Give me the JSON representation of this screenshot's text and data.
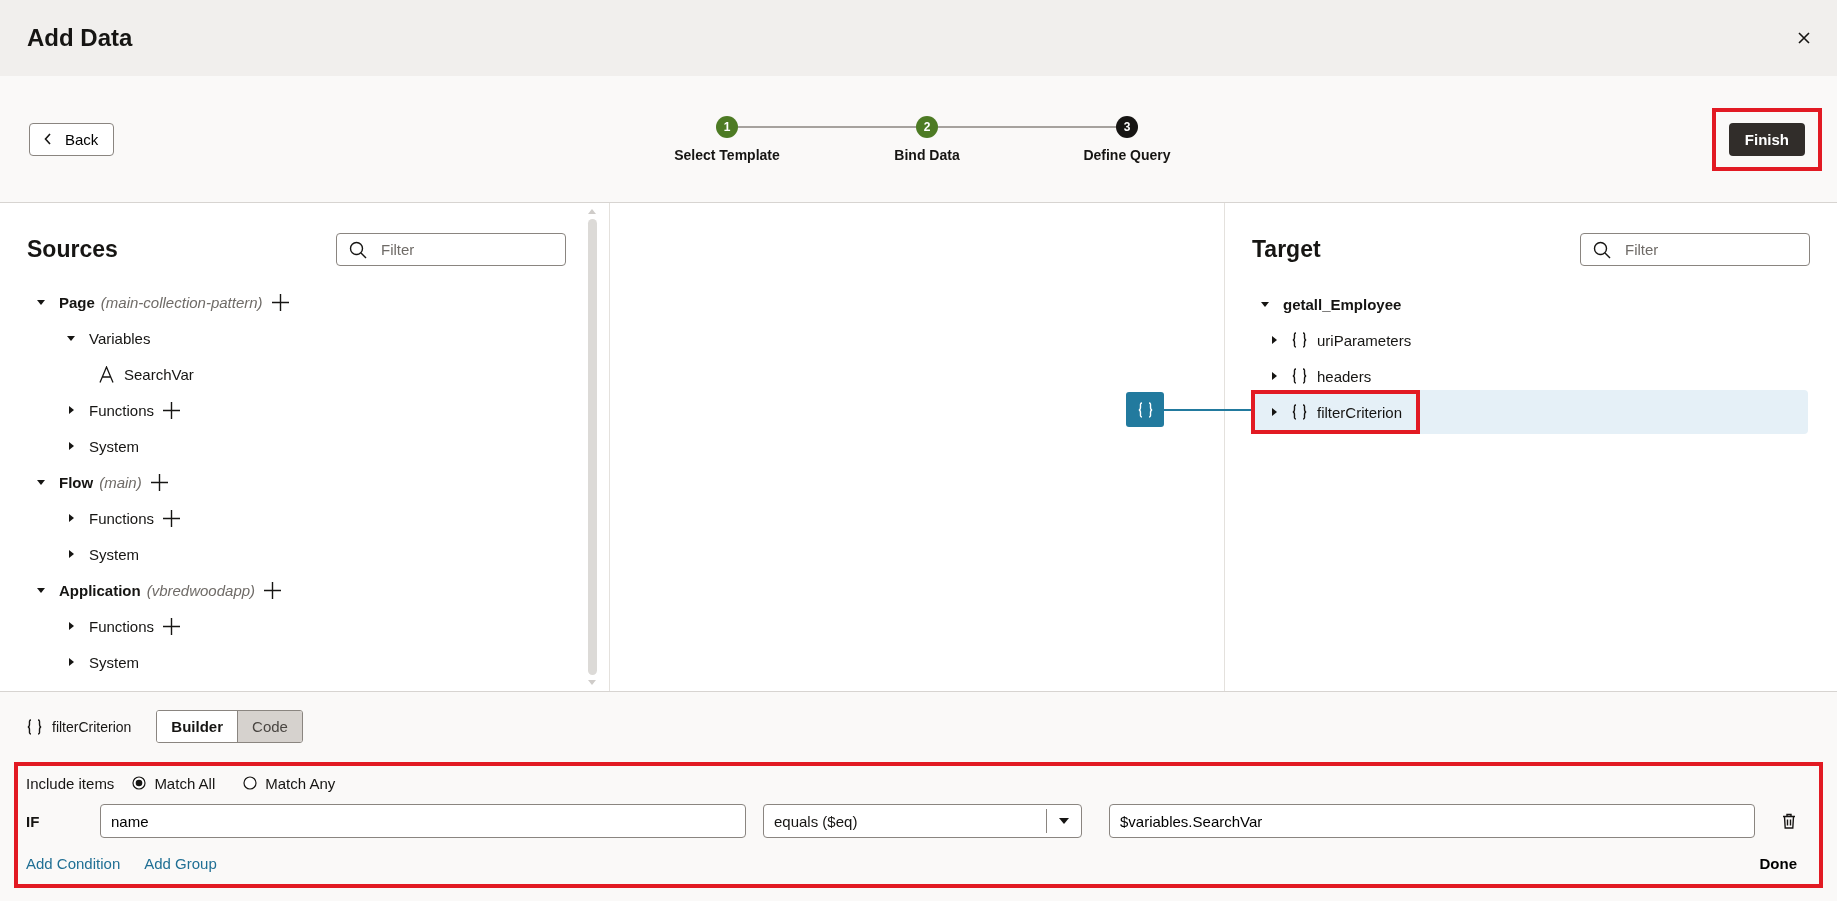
{
  "dialog": {
    "title": "Add Data"
  },
  "toolbar": {
    "back_button": "Back",
    "finish_button": {
      "label": "Finish",
      "highlighted": true
    }
  },
  "steps": [
    {
      "number": "1",
      "label": "Select Template",
      "completed": true
    },
    {
      "number": "2",
      "label": "Bind Data",
      "completed": true
    },
    {
      "number": "3",
      "label": "Define Query",
      "completed": false
    }
  ],
  "sources": {
    "title": "Sources",
    "filter": {
      "placeholder": "Filter"
    },
    "tree": [
      {
        "label": "Page",
        "note": "(main-collection-pattern)",
        "expanded": true,
        "addable": true,
        "children": [
          {
            "label": "Variables",
            "expanded": true,
            "addable": false,
            "children": [
              {
                "label": "SearchVar",
                "kind": "string"
              }
            ]
          },
          {
            "label": "Functions",
            "expanded": false,
            "addable": true
          },
          {
            "label": "System",
            "expanded": false,
            "addable": false
          }
        ]
      },
      {
        "label": "Flow",
        "note": "(main)",
        "expanded": true,
        "addable": true,
        "children": [
          {
            "label": "Functions",
            "expanded": false,
            "addable": true
          },
          {
            "label": "System",
            "expanded": false,
            "addable": false
          }
        ]
      },
      {
        "label": "Application",
        "note": "(vbredwoodapp)",
        "expanded": true,
        "addable": true,
        "children": [
          {
            "label": "Functions",
            "expanded": false,
            "addable": true
          },
          {
            "label": "System",
            "expanded": false,
            "addable": false
          }
        ]
      }
    ]
  },
  "target": {
    "title": "Target",
    "filter": {
      "placeholder": "Filter"
    },
    "root": {
      "label": "getall_Employee",
      "expanded": true,
      "children": [
        {
          "label": "uriParameters",
          "kind": "object",
          "expanded": false,
          "selected": false,
          "mapped": false,
          "highlighted": false
        },
        {
          "label": "headers",
          "kind": "object",
          "expanded": false,
          "selected": false,
          "mapped": false,
          "highlighted": false
        },
        {
          "label": "filterCriterion",
          "kind": "object",
          "expanded": false,
          "selected": true,
          "mapped": true,
          "highlighted": true
        }
      ]
    }
  },
  "editor": {
    "title": "filterCriterion",
    "modes": [
      {
        "label": "Builder",
        "selected": true
      },
      {
        "label": "Code",
        "selected": false
      }
    ],
    "builder": {
      "highlighted": true,
      "include_label": "Include items",
      "match_options": [
        {
          "label": "Match All",
          "selected": true
        },
        {
          "label": "Match Any",
          "selected": false
        }
      ],
      "conditions": [
        {
          "label": "IF",
          "field": "name",
          "operator": "equals ($eq)",
          "value": "$variables.SearchVar"
        }
      ],
      "links": [
        "Add Condition",
        "Add Group"
      ],
      "done_button": "Done"
    }
  }
}
